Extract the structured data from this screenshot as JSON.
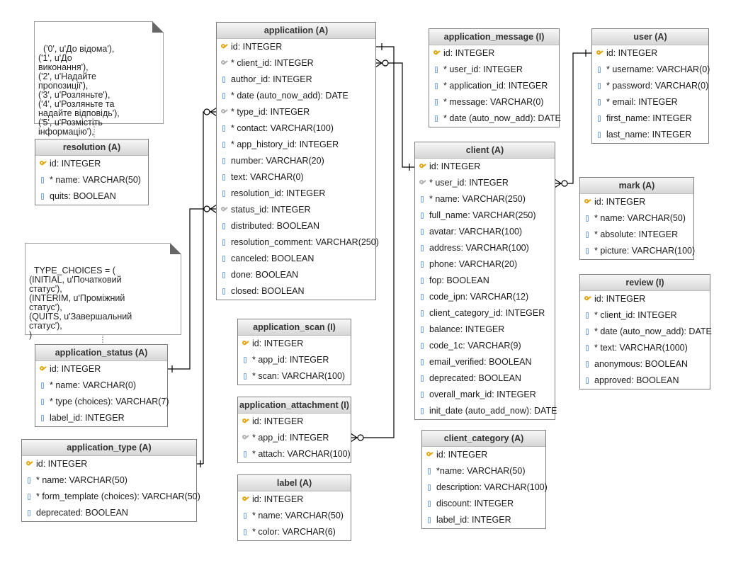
{
  "notes": {
    "resolution_choices": "('0', u'До відома'),\n('1', u'До\nвиконання'),\n('2', u'Надайте\nпропозиції'),\n('3', u'Розляньте'),\n('4', u'Розляньте та\nнадайте відповідь'),\n('5', u'Розмістіть\nінформацію'),",
    "status_type_choices": "TYPE_CHOICES = (\n(INITIAL, u'Початковий\nстатус'),\n(INTERIM, u'Проміжний\nстатус'),\n(QUITS, u'Завершальний\nстатус'),\n)"
  },
  "tables": {
    "resolution": {
      "title": "resolution (A)",
      "fields": [
        {
          "icon": "pk",
          "text": "id: INTEGER"
        },
        {
          "icon": "col",
          "text": "* name: VARCHAR(50)"
        },
        {
          "icon": "col",
          "text": "quits: BOOLEAN"
        }
      ]
    },
    "application": {
      "title": "applicatiion (A)",
      "fields": [
        {
          "icon": "pk",
          "text": "id: INTEGER"
        },
        {
          "icon": "fk",
          "text": "* client_id: INTEGER"
        },
        {
          "icon": "col",
          "text": "author_id: INTEGER"
        },
        {
          "icon": "col",
          "text": "* date (auto_now_add): DATE"
        },
        {
          "icon": "fk",
          "text": "* type_id: INTEGER"
        },
        {
          "icon": "col",
          "text": "* contact: VARCHAR(100)"
        },
        {
          "icon": "col",
          "text": "* app_history_id: INTEGER"
        },
        {
          "icon": "col",
          "text": "number: VARCHAR(20)"
        },
        {
          "icon": "col",
          "text": "text: VARCHAR(0)"
        },
        {
          "icon": "col",
          "text": "resolution_id: INTEGER"
        },
        {
          "icon": "fk",
          "text": "status_id: INTEGER"
        },
        {
          "icon": "col",
          "text": "distributed: BOOLEAN"
        },
        {
          "icon": "col",
          "text": "resolution_comment: VARCHAR(250)"
        },
        {
          "icon": "col",
          "text": "canceled: BOOLEAN"
        },
        {
          "icon": "col",
          "text": "done: BOOLEAN"
        },
        {
          "icon": "col",
          "text": "closed: BOOLEAN"
        }
      ]
    },
    "application_message": {
      "title": "application_message (I)",
      "fields": [
        {
          "icon": "pk",
          "text": "id: INTEGER"
        },
        {
          "icon": "col",
          "text": "* user_id: INTEGER"
        },
        {
          "icon": "col",
          "text": "* application_id: INTEGER"
        },
        {
          "icon": "col",
          "text": "* message: VARCHAR(0)"
        },
        {
          "icon": "col",
          "text": "* date (auto_now_add): DATE"
        }
      ]
    },
    "user": {
      "title": "user (A)",
      "fields": [
        {
          "icon": "pk",
          "text": "id: INTEGER"
        },
        {
          "icon": "col",
          "text": "* username: VARCHAR(0)"
        },
        {
          "icon": "col",
          "text": "* password: VARCHAR(0)"
        },
        {
          "icon": "col",
          "text": "* email: INTEGER"
        },
        {
          "icon": "col",
          "text": "first_name: INTEGER"
        },
        {
          "icon": "col",
          "text": "last_name: INTEGER"
        }
      ]
    },
    "client": {
      "title": "client (A)",
      "fields": [
        {
          "icon": "pk",
          "text": "id: INTEGER"
        },
        {
          "icon": "fk",
          "text": "* user_id: INTEGER"
        },
        {
          "icon": "col",
          "text": "* name: VARCHAR(250)"
        },
        {
          "icon": "col",
          "text": "full_name: VARCHAR(250)"
        },
        {
          "icon": "col",
          "text": "avatar: VARCHAR(100)"
        },
        {
          "icon": "col",
          "text": "address: VARCHAR(100)"
        },
        {
          "icon": "col",
          "text": "phone: VARCHAR(20)"
        },
        {
          "icon": "col",
          "text": "fop: BOOLEAN"
        },
        {
          "icon": "col",
          "text": "code_ipn: VARCHAR(12)"
        },
        {
          "icon": "col",
          "text": "client_category_id: INTEGER"
        },
        {
          "icon": "col",
          "text": "balance: INTEGER"
        },
        {
          "icon": "col",
          "text": "code_1c: VARCHAR(9)"
        },
        {
          "icon": "col",
          "text": "email_verified: BOOLEAN"
        },
        {
          "icon": "col",
          "text": "deprecated: BOOLEAN"
        },
        {
          "icon": "col",
          "text": "overall_mark_id: INTEGER"
        },
        {
          "icon": "col",
          "text": "init_date (auto_add_now): DATE"
        }
      ]
    },
    "mark": {
      "title": "mark (A)",
      "fields": [
        {
          "icon": "pk",
          "text": "id: INTEGER"
        },
        {
          "icon": "col",
          "text": "* name: VARCHAR(50)"
        },
        {
          "icon": "col",
          "text": "* absolute: INTEGER"
        },
        {
          "icon": "col",
          "text": "* picture: VARCHAR(100)"
        }
      ]
    },
    "review": {
      "title": "review (I)",
      "fields": [
        {
          "icon": "pk",
          "text": "id: INTEGER"
        },
        {
          "icon": "col",
          "text": "* client_id: INTEGER"
        },
        {
          "icon": "col",
          "text": "* date (auto_now_add): DATE"
        },
        {
          "icon": "col",
          "text": "* text: VARCHAR(1000)"
        },
        {
          "icon": "col",
          "text": "anonymous: BOOLEAN"
        },
        {
          "icon": "col",
          "text": "approved: BOOLEAN"
        }
      ]
    },
    "application_status": {
      "title": "application_status (A)",
      "fields": [
        {
          "icon": "pk",
          "text": "id: INTEGER"
        },
        {
          "icon": "col",
          "text": "* name: VARCHAR(0)"
        },
        {
          "icon": "col",
          "text": "* type (choices): VARCHAR(7)"
        },
        {
          "icon": "col",
          "text": "label_id: INTEGER"
        }
      ]
    },
    "application_type": {
      "title": "application_type (A)",
      "fields": [
        {
          "icon": "pk",
          "text": "id: INTEGER"
        },
        {
          "icon": "col",
          "text": "* name: VARCHAR(50)"
        },
        {
          "icon": "col",
          "text": "* form_template (choices): VARCHAR(50)"
        },
        {
          "icon": "col",
          "text": "deprecated: BOOLEAN"
        }
      ]
    },
    "application_scan": {
      "title": "application_scan (I)",
      "fields": [
        {
          "icon": "pk",
          "text": "id: INTEGER"
        },
        {
          "icon": "col",
          "text": "* app_id: INTEGER"
        },
        {
          "icon": "col",
          "text": "* scan: VARCHAR(100)"
        }
      ]
    },
    "application_attachment": {
      "title": "application_attachment (I)",
      "fields": [
        {
          "icon": "pk",
          "text": "id: INTEGER"
        },
        {
          "icon": "fk",
          "text": "* app_id: INTEGER"
        },
        {
          "icon": "col",
          "text": "* attach: VARCHAR(100)"
        }
      ]
    },
    "label": {
      "title": "label (A)",
      "fields": [
        {
          "icon": "pk",
          "text": "id: INTEGER"
        },
        {
          "icon": "col",
          "text": "* name: VARCHAR(50)"
        },
        {
          "icon": "col",
          "text": "* color: VARCHAR(6)"
        }
      ]
    },
    "client_category": {
      "title": "client_category (A)",
      "fields": [
        {
          "icon": "pk",
          "text": "id: INTEGER"
        },
        {
          "icon": "col",
          "text": "*name: VARCHAR(50)"
        },
        {
          "icon": "col",
          "text": "description: VARCHAR(100)"
        },
        {
          "icon": "col",
          "text": "discount: INTEGER"
        },
        {
          "icon": "col",
          "text": "label_id: INTEGER"
        }
      ]
    }
  },
  "relationships": [
    {
      "from": "application.type_id",
      "to": "application_type.id",
      "cardinality": "many-to-one"
    },
    {
      "from": "application.status_id",
      "to": "application_status.id",
      "cardinality": "many-to-one"
    },
    {
      "from": "application.client_id",
      "to": "client.id",
      "cardinality": "many-to-one"
    },
    {
      "from": "application_attachment.app_id",
      "to": "application.id",
      "cardinality": "many-to-one"
    },
    {
      "from": "client.user_id",
      "to": "user.id",
      "cardinality": "many-to-one"
    }
  ]
}
